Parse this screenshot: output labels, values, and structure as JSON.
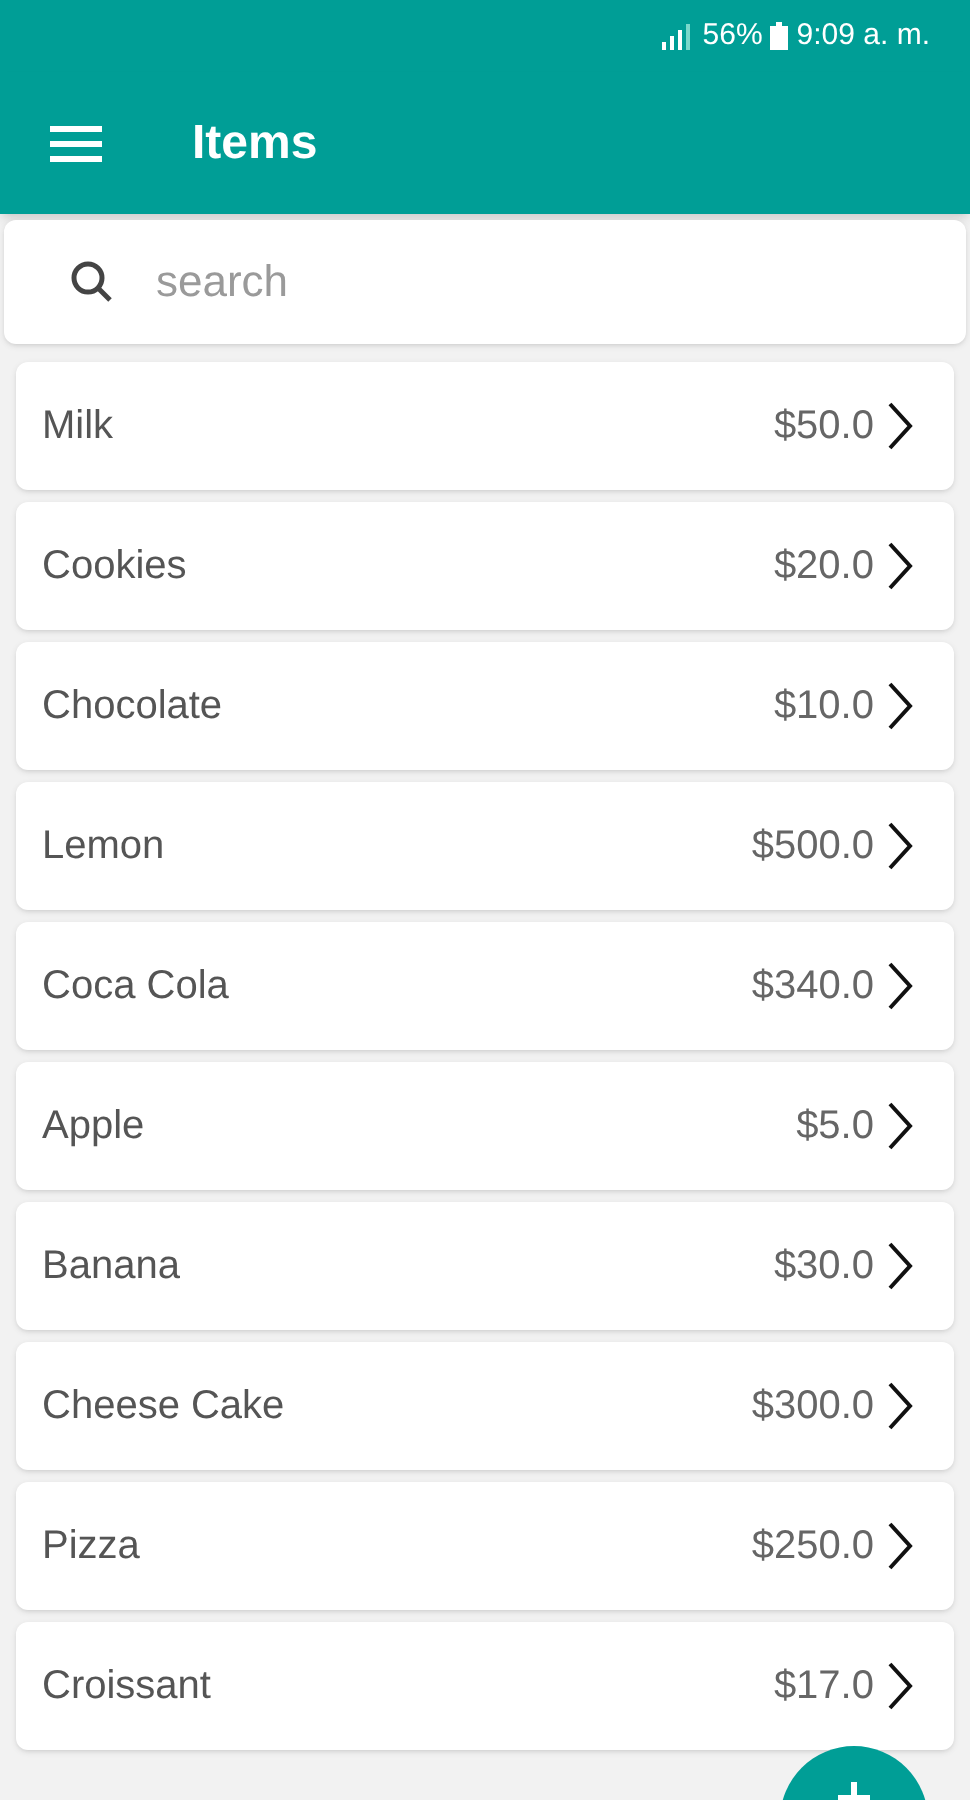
{
  "status_bar": {
    "battery": "56%",
    "time": "9:09 a. m."
  },
  "app_bar": {
    "title": "Items"
  },
  "search": {
    "placeholder": "search"
  },
  "items": [
    {
      "name": "Milk",
      "price": "$50.0"
    },
    {
      "name": "Cookies",
      "price": "$20.0"
    },
    {
      "name": "Chocolate",
      "price": "$10.0"
    },
    {
      "name": "Lemon",
      "price": "$500.0"
    },
    {
      "name": "Coca Cola",
      "price": "$340.0"
    },
    {
      "name": "Apple",
      "price": "$5.0"
    },
    {
      "name": "Banana",
      "price": "$30.0"
    },
    {
      "name": "Cheese Cake",
      "price": "$300.0"
    },
    {
      "name": "Pizza",
      "price": "$250.0"
    },
    {
      "name": "Croissant",
      "price": "$17.0"
    }
  ]
}
